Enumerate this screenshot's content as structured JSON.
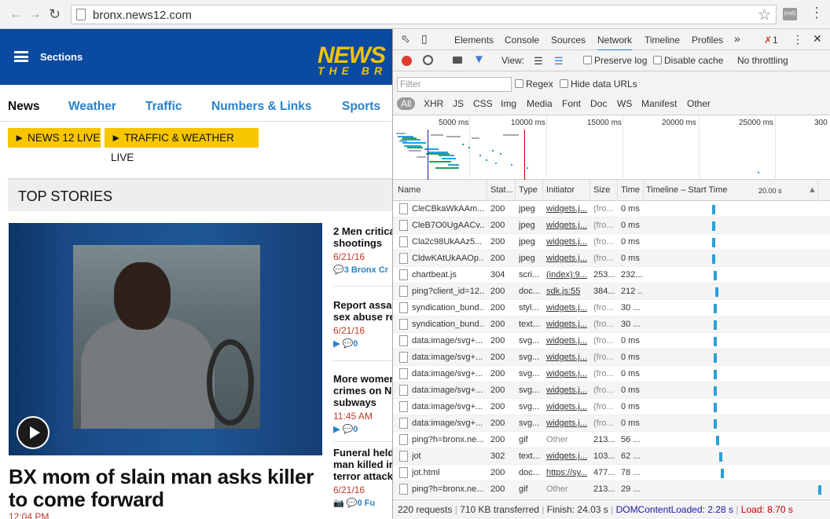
{
  "browser": {
    "back_icon": "back-arrow-icon",
    "forward_icon": "forward-arrow-icon",
    "reload_icon": "reload-icon",
    "url": "bronx.news12.com",
    "extension_label": "(md)",
    "menu_icon": "vertical-ellipsis-icon"
  },
  "site": {
    "header_color": "#0a4aa0",
    "sections_label": "Sections",
    "logo_text": "NEWS",
    "logo_subtext": "THE BR",
    "nav": [
      "News",
      "Weather",
      "Traffic",
      "Numbers & Links",
      "Sports"
    ],
    "live_buttons": [
      "► NEWS 12 LIVE",
      "► TRAFFIC & WEATHER LIVE"
    ],
    "top_stories_label": "TOP STORIES",
    "headline": "BX mom of slain man asks killer to come forward",
    "headline_time": "12:04 PM",
    "stories": [
      {
        "title_lines": [
          "2 Men critical",
          "shootings"
        ],
        "time": "6/21/16",
        "meta": "💬3  Bronx Cr"
      },
      {
        "title_lines": [
          "Report assail",
          "sex abuse re"
        ],
        "time": "6/21/16",
        "meta": "▶ 💬0"
      },
      {
        "title_lines": [
          "More women",
          "crimes on N",
          "subways"
        ],
        "time": "11:45 AM",
        "meta": "▶ 💬0"
      },
      {
        "title_lines": [
          "Funeral held",
          "man killed ir",
          "terror attack"
        ],
        "time": "6/21/16",
        "meta": "📷 💬0  Fu"
      }
    ]
  },
  "devtools": {
    "tabs": [
      "Elements",
      "Console",
      "Sources",
      "Network",
      "Timeline",
      "Profiles"
    ],
    "more_tabs": "»",
    "error_count": "1",
    "toolbar": {
      "view_label": "View:",
      "preserve_log": "Preserve log",
      "disable_cache": "Disable cache",
      "throttling": "No throttling"
    },
    "filter_placeholder": "Filter",
    "regex_label": "Regex",
    "hide_data_urls_label": "Hide data URLs",
    "types": [
      "All",
      "XHR",
      "JS",
      "CSS",
      "Img",
      "Media",
      "Font",
      "Doc",
      "WS",
      "Manifest",
      "Other"
    ],
    "overview_ticks": [
      "5000 ms",
      "10000 ms",
      "15000 ms",
      "20000 ms",
      "25000 ms",
      "300"
    ],
    "columns": {
      "name": "Name",
      "status": "Stat...",
      "type": "Type",
      "initiator": "Initiator",
      "size": "Size",
      "time": "Time",
      "timeline": "Timeline – Start Time",
      "timeline_marker": "20.00 s",
      "sort_icon": "▲"
    },
    "requests": [
      {
        "name": "CleCBkaWkAAm...",
        "status": "200",
        "type": "jpeg",
        "initiator": "widgets.j...",
        "size": "(fro...",
        "time": "0 ms"
      },
      {
        "name": "CleB7O0UgAACv...",
        "status": "200",
        "type": "jpeg",
        "initiator": "widgets.j...",
        "size": "(fro...",
        "time": "0 ms"
      },
      {
        "name": "Cla2c98UkAAz5...",
        "status": "200",
        "type": "jpeg",
        "initiator": "widgets.j...",
        "size": "(fro...",
        "time": "0 ms"
      },
      {
        "name": "CldwKAtUkAAOp...",
        "status": "200",
        "type": "jpeg",
        "initiator": "widgets.j...",
        "size": "(fro...",
        "time": "0 ms"
      },
      {
        "name": "chartbeat.js",
        "status": "304",
        "type": "scri...",
        "initiator": "(index):9...",
        "size": "253...",
        "time": "232..."
      },
      {
        "name": "ping?client_id=12...",
        "status": "200",
        "type": "doc...",
        "initiator": "sdk.js:55",
        "size": "384...",
        "time": "212 ..."
      },
      {
        "name": "syndication_bund...",
        "status": "200",
        "type": "styl...",
        "initiator": "widgets.j...",
        "size": "(fro...",
        "time": "30 ..."
      },
      {
        "name": "syndication_bund...",
        "status": "200",
        "type": "text...",
        "initiator": "widgets.j...",
        "size": "(fro...",
        "time": "30 ..."
      },
      {
        "name": "data:image/svg+...",
        "status": "200",
        "type": "svg...",
        "initiator": "widgets.j...",
        "size": "(fro...",
        "time": "0 ms"
      },
      {
        "name": "data:image/svg+...",
        "status": "200",
        "type": "svg...",
        "initiator": "widgets.j...",
        "size": "(fro...",
        "time": "0 ms"
      },
      {
        "name": "data:image/svg+...",
        "status": "200",
        "type": "svg...",
        "initiator": "widgets.j...",
        "size": "(fro...",
        "time": "0 ms"
      },
      {
        "name": "data:image/svg+...",
        "status": "200",
        "type": "svg...",
        "initiator": "widgets.j...",
        "size": "(fro...",
        "time": "0 ms"
      },
      {
        "name": "data:image/svg+...",
        "status": "200",
        "type": "svg...",
        "initiator": "widgets.j...",
        "size": "(fro...",
        "time": "0 ms"
      },
      {
        "name": "data:image/svg+...",
        "status": "200",
        "type": "svg...",
        "initiator": "widgets.j...",
        "size": "(fro...",
        "time": "0 ms"
      },
      {
        "name": "ping?h=bronx.ne...",
        "status": "200",
        "type": "gif",
        "initiator": "Other",
        "size": "213...",
        "time": "56 ..."
      },
      {
        "name": "jot",
        "status": "302",
        "type": "text...",
        "initiator": "widgets.j...",
        "size": "103...",
        "time": "62 ..."
      },
      {
        "name": "jot.html",
        "status": "200",
        "type": "doc...",
        "initiator": "https://sy...",
        "size": "477...",
        "time": "78 ..."
      },
      {
        "name": "ping?h=bronx.ne...",
        "status": "200",
        "type": "gif",
        "initiator": "Other",
        "size": "213...",
        "time": "29 ..."
      }
    ],
    "status": {
      "requests": "220 requests",
      "transferred": "710 KB transferred",
      "finish": "Finish: 24.03 s",
      "dom_content_loaded": "DOMContentLoaded: 2.28 s",
      "load": "Load: 8.70 s",
      "dcl_color": "#1a1aa6",
      "load_color": "#c00000"
    }
  }
}
